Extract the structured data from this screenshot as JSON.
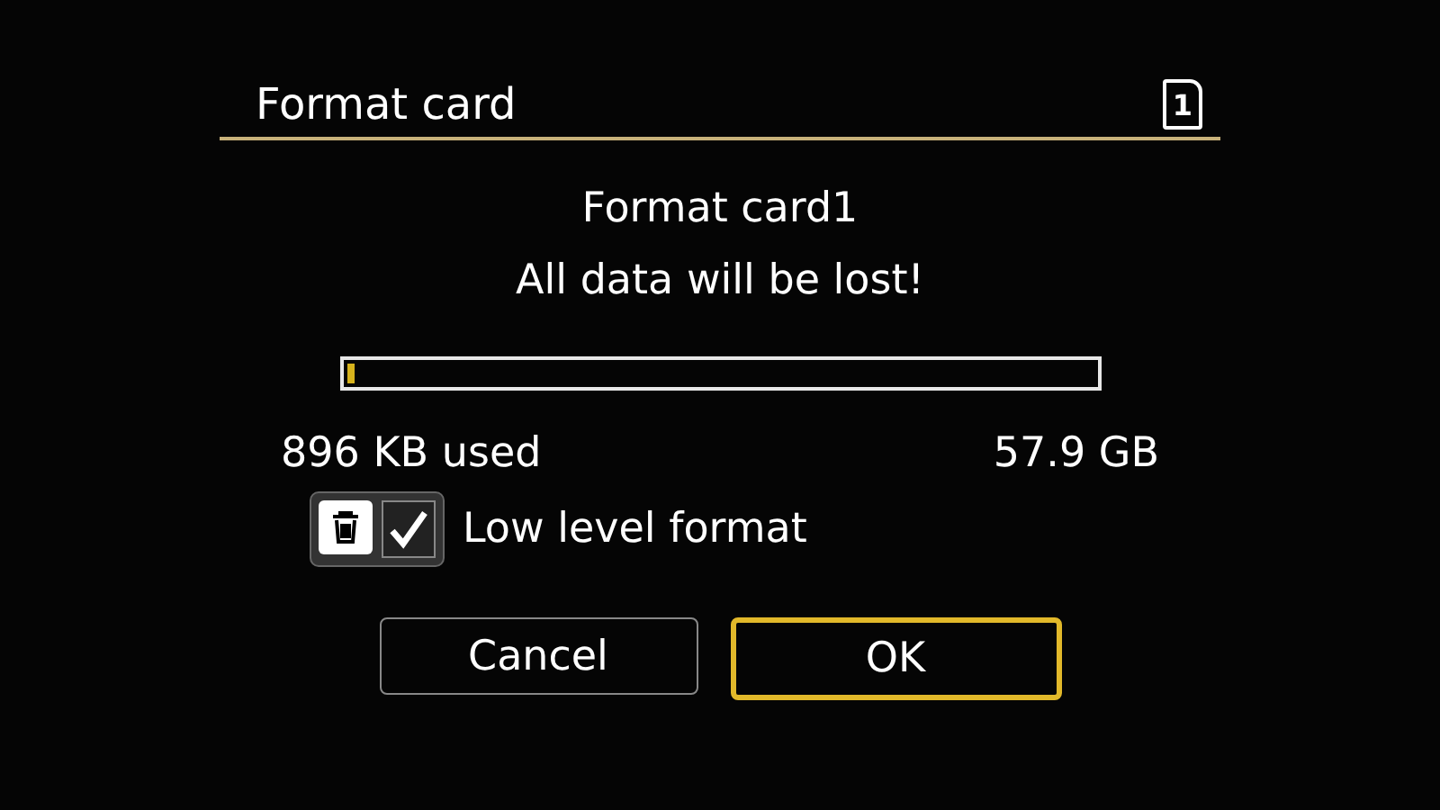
{
  "header": {
    "title": "Format card",
    "card_number": "1"
  },
  "message": [
    "Format card1",
    "All data will be lost!"
  ],
  "capacity": {
    "level": 0.01,
    "used": "896 KB used",
    "total": "57.9 GB"
  },
  "low_level_format": {
    "label": "Low level format",
    "checked": true
  },
  "buttons": [
    {
      "label": "Cancel",
      "selected": false
    },
    {
      "label": "OK",
      "selected": true
    }
  ]
}
